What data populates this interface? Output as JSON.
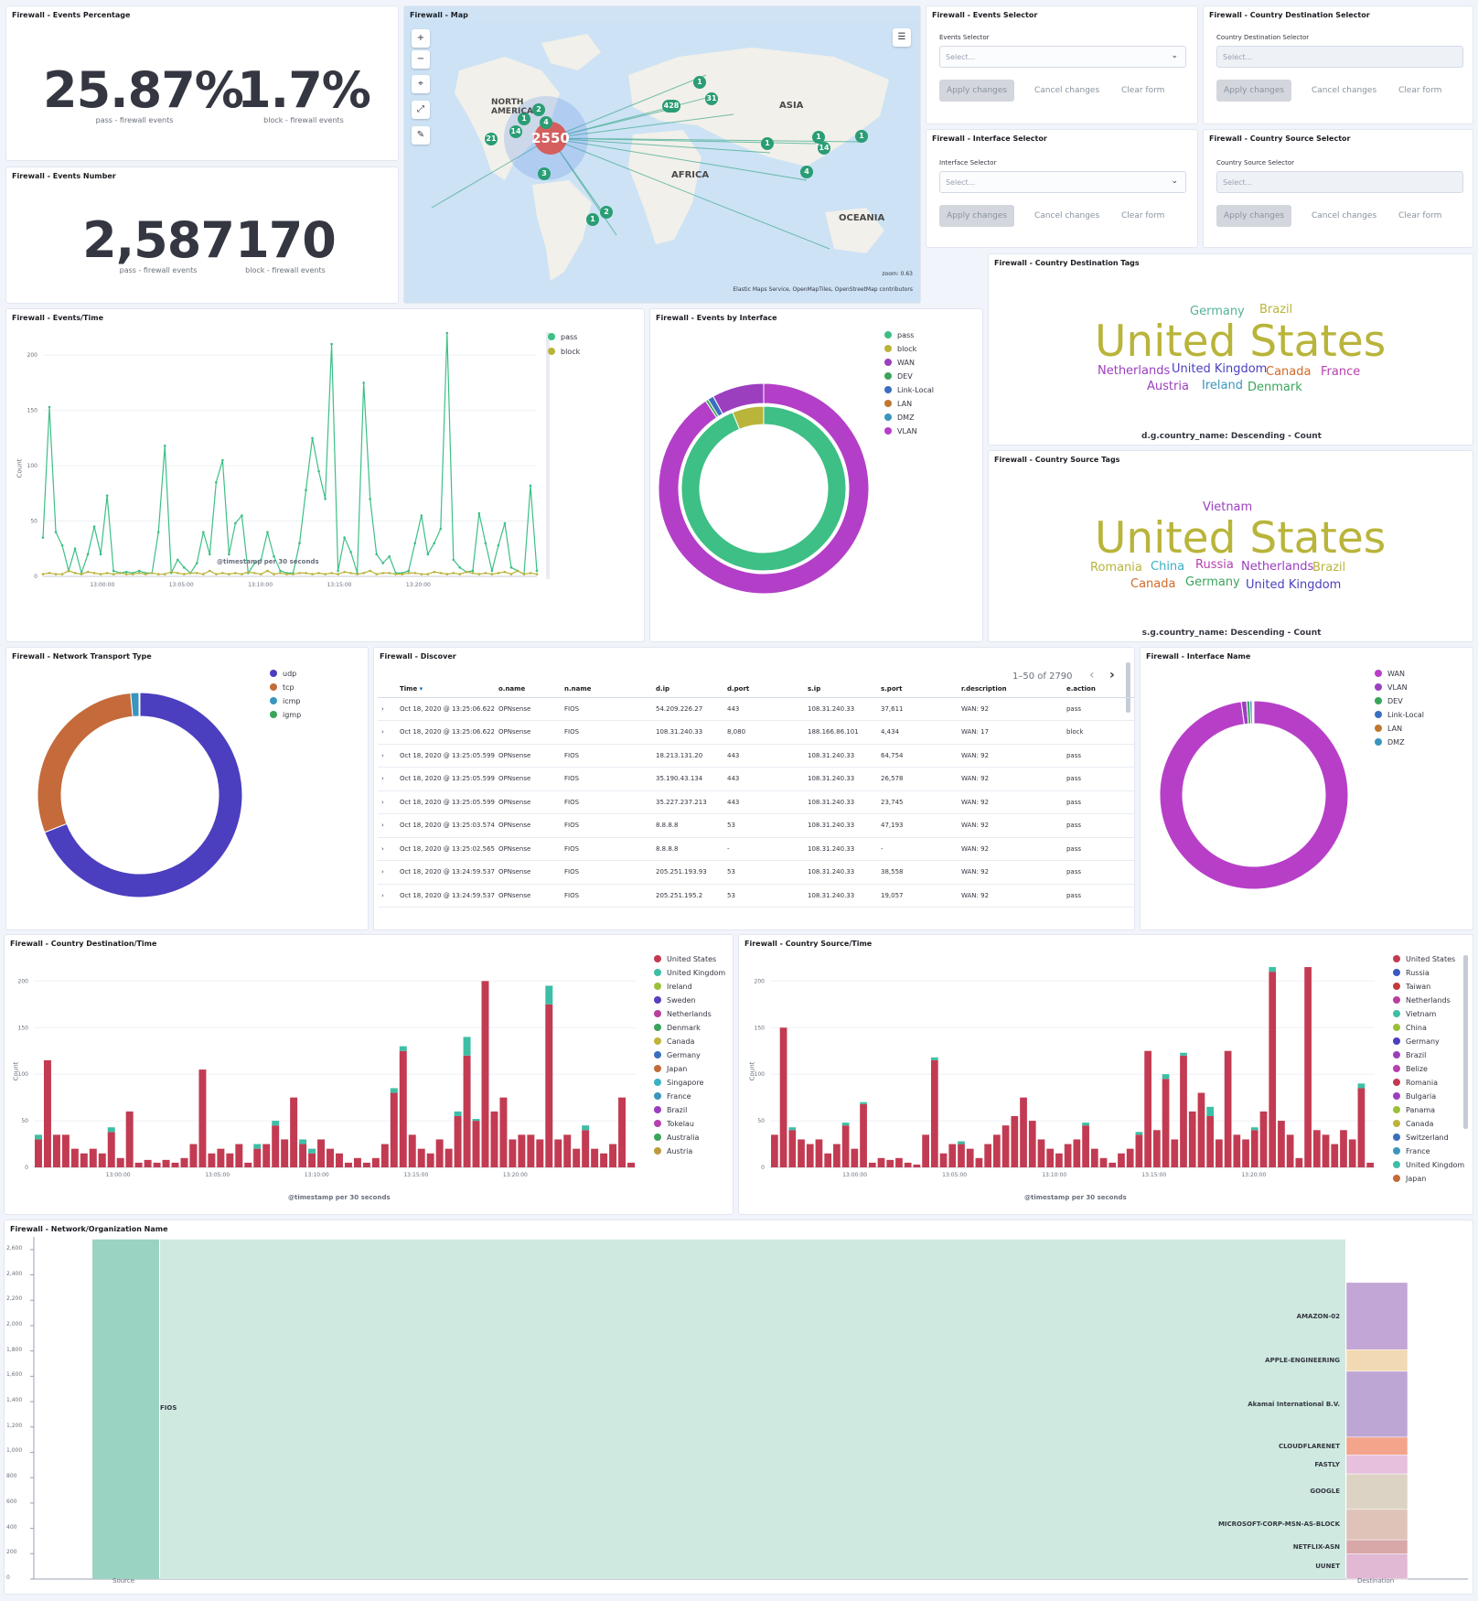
{
  "events_percentage": {
    "title": "Firewall - Events Percentage",
    "metrics": [
      {
        "value": "25.87%",
        "label": "pass - firewall events"
      },
      {
        "value": "1.7%",
        "label": "block - firewall events"
      }
    ]
  },
  "events_number": {
    "title": "Firewall - Events Number",
    "metrics": [
      {
        "value": "2,587",
        "label": "pass - firewall events"
      },
      {
        "value": "170",
        "label": "block - firewall events"
      }
    ]
  },
  "map": {
    "title": "Firewall - Map",
    "center_count": "2550",
    "zoom": "zoom: 0.63",
    "attribution": "Elastic Maps Service, OpenMapTiles, OpenStreetMap contributors",
    "labels": {
      "na": "NORTH AMERICA",
      "asia": "ASIA",
      "africa": "AFRICA",
      "oceania": "OCEANIA"
    },
    "clusters": [
      "2",
      "1",
      "14",
      "21",
      "3",
      "1",
      "2",
      "428",
      "31",
      "1",
      "1",
      "1",
      "14",
      "4",
      "1",
      "4"
    ],
    "controls": {
      "zoom_in": "+",
      "zoom_out": "−",
      "locate": "⌖",
      "expand": "⤢",
      "tools": "✎",
      "layers": "☰"
    }
  },
  "selectors": {
    "apply": "Apply changes",
    "cancel": "Cancel changes",
    "clear": "Clear form",
    "placeholder": "Select...",
    "events": {
      "title": "Firewall - Events Selector",
      "label": "Events Selector"
    },
    "country_dest": {
      "title": "Firewall - Country Destination Selector",
      "label": "Country Destination Selector"
    },
    "interface": {
      "title": "Firewall - Interface Selector",
      "label": "Interface Selector"
    },
    "country_src": {
      "title": "Firewall - Country Source Selector",
      "label": "Country Source Selector"
    }
  },
  "dest_tags": {
    "title": "Firewall - Country Destination Tags",
    "caption": "d.g.country_name: Descending - Count",
    "tags": [
      {
        "t": "Germany",
        "c": "#54b399"
      },
      {
        "t": "Brazil",
        "c": "#b9b43a"
      },
      {
        "t": "United States",
        "c": "#b9b43a"
      },
      {
        "t": "Netherlands",
        "c": "#9c3fbf"
      },
      {
        "t": "United Kingdom",
        "c": "#4b3fbf"
      },
      {
        "t": "Canada",
        "c": "#d36a2a"
      },
      {
        "t": "France",
        "c": "#b73fae"
      },
      {
        "t": "Austria",
        "c": "#9c3fbf"
      },
      {
        "t": "Ireland",
        "c": "#3a95be"
      },
      {
        "t": "Denmark",
        "c": "#3aa55a"
      }
    ]
  },
  "src_tags": {
    "title": "Firewall - Country Source Tags",
    "caption": "s.g.country_name: Descending - Count",
    "tags": [
      {
        "t": "Vietnam",
        "c": "#9c3fbf"
      },
      {
        "t": "United States",
        "c": "#b9b43a"
      },
      {
        "t": "Romania",
        "c": "#b9b43a"
      },
      {
        "t": "China",
        "c": "#3ab0c6"
      },
      {
        "t": "Russia",
        "c": "#b73fae"
      },
      {
        "t": "Netherlands",
        "c": "#9c3fbf"
      },
      {
        "t": "Brazil",
        "c": "#b9b43a"
      },
      {
        "t": "Canada",
        "c": "#d36a2a"
      },
      {
        "t": "Germany",
        "c": "#3aa55a"
      },
      {
        "t": "United Kingdom",
        "c": "#4b3fbf"
      }
    ]
  },
  "events_time": {
    "title": "Firewall - Events/Time",
    "legend": [
      {
        "name": "pass",
        "color": "#3dbf85"
      },
      {
        "name": "block",
        "color": "#b9b43a"
      }
    ]
  },
  "events_interface": {
    "title": "Firewall - Events by Interface",
    "legend": [
      {
        "name": "pass",
        "color": "#3dbf85"
      },
      {
        "name": "block",
        "color": "#b9b43a"
      },
      {
        "name": "WAN",
        "color": "#9c3fbf"
      },
      {
        "name": "DEV",
        "color": "#3aa55a"
      },
      {
        "name": "Link-Local",
        "color": "#3a6fbf"
      },
      {
        "name": "LAN",
        "color": "#c0772d"
      },
      {
        "name": "DMZ",
        "color": "#3a95be"
      },
      {
        "name": "VLAN",
        "color": "#b73fc8"
      }
    ]
  },
  "transport": {
    "title": "Firewall - Network Transport Type",
    "legend": [
      {
        "name": "udp",
        "color": "#4b3fbf"
      },
      {
        "name": "tcp",
        "color": "#c56a3a"
      },
      {
        "name": "icmp",
        "color": "#3a95be"
      },
      {
        "name": "igmp",
        "color": "#3aa55a"
      }
    ]
  },
  "interface_name": {
    "title": "Firewall - Interface Name",
    "legend": [
      {
        "name": "WAN",
        "color": "#b73fc8"
      },
      {
        "name": "VLAN",
        "color": "#9c3fbf"
      },
      {
        "name": "DEV",
        "color": "#3aa55a"
      },
      {
        "name": "Link-Local",
        "color": "#3a6fbf"
      },
      {
        "name": "LAN",
        "color": "#c0772d"
      },
      {
        "name": "DMZ",
        "color": "#3a95be"
      }
    ]
  },
  "discover": {
    "title": "Firewall - Discover",
    "pagination": "1–50 of 2790",
    "columns": [
      "Time",
      "o.name",
      "n.name",
      "d.ip",
      "d.port",
      "s.ip",
      "s.port",
      "r.description",
      "e.action"
    ],
    "rows": [
      [
        "Oct 18, 2020 @ 13:25:06.622",
        "OPNsense",
        "FIOS",
        "54.209.226.27",
        "443",
        "108.31.240.33",
        "37,611",
        "WAN: 92",
        "pass"
      ],
      [
        "Oct 18, 2020 @ 13:25:06.622",
        "OPNsense",
        "FIOS",
        "108.31.240.33",
        "8,080",
        "188.166.86.101",
        "4,434",
        "WAN: 17",
        "block"
      ],
      [
        "Oct 18, 2020 @ 13:25:05.599",
        "OPNsense",
        "FIOS",
        "18.213.131.20",
        "443",
        "108.31.240.33",
        "64,754",
        "WAN: 92",
        "pass"
      ],
      [
        "Oct 18, 2020 @ 13:25:05.599",
        "OPNsense",
        "FIOS",
        "35.190.43.134",
        "443",
        "108.31.240.33",
        "26,578",
        "WAN: 92",
        "pass"
      ],
      [
        "Oct 18, 2020 @ 13:25:05.599",
        "OPNsense",
        "FIOS",
        "35.227.237.213",
        "443",
        "108.31.240.33",
        "23,745",
        "WAN: 92",
        "pass"
      ],
      [
        "Oct 18, 2020 @ 13:25:03.574",
        "OPNsense",
        "FIOS",
        "8.8.8.8",
        "53",
        "108.31.240.33",
        "47,193",
        "WAN: 92",
        "pass"
      ],
      [
        "Oct 18, 2020 @ 13:25:02.565",
        "OPNsense",
        "FIOS",
        "8.8.8.8",
        "-",
        "108.31.240.33",
        "-",
        "WAN: 92",
        "pass"
      ],
      [
        "Oct 18, 2020 @ 13:24:59.537",
        "OPNsense",
        "FIOS",
        "205.251.193.93",
        "53",
        "108.31.240.33",
        "38,558",
        "WAN: 92",
        "pass"
      ],
      [
        "Oct 18, 2020 @ 13:24:59.537",
        "OPNsense",
        "FIOS",
        "205.251.195.2",
        "53",
        "108.31.240.33",
        "19,057",
        "WAN: 92",
        "pass"
      ]
    ]
  },
  "country_dest_time": {
    "title": "Firewall - Country Destination/Time",
    "xlabel": "@timestamp per 30 seconds",
    "ylabel": "Count",
    "legend": [
      {
        "name": "United States",
        "color": "#c23b52"
      },
      {
        "name": "United Kingdom",
        "color": "#3dbfa5"
      },
      {
        "name": "Ireland",
        "color": "#9cbf3a"
      },
      {
        "name": "Sweden",
        "color": "#5a3fbf"
      },
      {
        "name": "Netherlands",
        "color": "#b73f9e"
      },
      {
        "name": "Denmark",
        "color": "#3aa55a"
      },
      {
        "name": "Canada",
        "color": "#bfb43a"
      },
      {
        "name": "Germany",
        "color": "#3a6fbf"
      },
      {
        "name": "Japan",
        "color": "#c56a3a"
      },
      {
        "name": "Singapore",
        "color": "#3ab0c6"
      },
      {
        "name": "France",
        "color": "#3a95be"
      },
      {
        "name": "Brazil",
        "color": "#9c3fbf"
      },
      {
        "name": "Tokelau",
        "color": "#b73fae"
      },
      {
        "name": "Australia",
        "color": "#3aa55a"
      },
      {
        "name": "Austria",
        "color": "#bf9a3a"
      }
    ]
  },
  "country_src_time": {
    "title": "Firewall - Country Source/Time",
    "xlabel": "@timestamp per 30 seconds",
    "ylabel": "Count",
    "legend": [
      {
        "name": "United States",
        "color": "#c23b52"
      },
      {
        "name": "Russia",
        "color": "#3a5abf"
      },
      {
        "name": "Taiwan",
        "color": "#c23b3b"
      },
      {
        "name": "Netherlands",
        "color": "#b73f9e"
      },
      {
        "name": "Vietnam",
        "color": "#3dbfa5"
      },
      {
        "name": "China",
        "color": "#9cbf3a"
      },
      {
        "name": "Germany",
        "color": "#4b3fbf"
      },
      {
        "name": "Brazil",
        "color": "#9c3fbf"
      },
      {
        "name": "Belize",
        "color": "#b73fae"
      },
      {
        "name": "Romania",
        "color": "#c23b52"
      },
      {
        "name": "Bulgaria",
        "color": "#9c3fbf"
      },
      {
        "name": "Panama",
        "color": "#9cbf3a"
      },
      {
        "name": "Canada",
        "color": "#bfb43a"
      },
      {
        "name": "Switzerland",
        "color": "#3a6fbf"
      },
      {
        "name": "France",
        "color": "#3a95be"
      },
      {
        "name": "United Kingdom",
        "color": "#3dbfa5"
      },
      {
        "name": "Japan",
        "color": "#c56a3a"
      }
    ]
  },
  "org": {
    "title": "Firewall - Network/Organization Name",
    "source_name": "FIOS",
    "xlabels": [
      "Source",
      "Destination"
    ],
    "yticks": [
      "2,600",
      "2,400",
      "2,200",
      "2,000",
      "1,800",
      "1,600",
      "1,400",
      "1,200",
      "1,000",
      "800",
      "600",
      "400",
      "200",
      "0"
    ],
    "dest": [
      "AMAZON-02",
      "APPLE-ENGINEERING",
      "Akamai International B.V.",
      "CLOUDFLARENET",
      "FASTLY",
      "GOOGLE",
      "MICROSOFT-CORP-MSN-AS-BLOCK",
      "NETFLIX-ASN",
      "UUNET"
    ]
  },
  "chart_data": [
    {
      "type": "line",
      "title": "Firewall - Events/Time",
      "xlabel": "@timestamp per 30 seconds",
      "ylabel": "Count",
      "ylim": [
        0,
        220
      ],
      "x": [
        "13:00:00",
        "13:05:00",
        "13:10:00",
        "13:15:00",
        "13:20:00"
      ],
      "series": [
        {
          "name": "pass",
          "values": [
            35,
            153,
            40,
            28,
            5,
            25,
            3,
            20,
            45,
            20,
            73,
            5,
            3,
            4,
            3,
            5,
            3,
            3,
            40,
            118,
            3,
            15,
            8,
            3,
            12,
            40,
            20,
            85,
            105,
            20,
            48,
            55,
            3,
            12,
            15,
            40,
            18,
            5,
            3,
            3,
            30,
            78,
            125,
            95,
            70,
            210,
            5,
            35,
            22,
            3,
            175,
            70,
            20,
            12,
            18,
            3,
            3,
            5,
            30,
            55,
            20,
            30,
            43,
            220,
            15,
            8,
            4,
            5,
            57,
            30,
            5,
            28,
            48,
            8,
            5,
            2,
            82,
            5
          ]
        },
        {
          "name": "block",
          "values": [
            2,
            3,
            2,
            2,
            5,
            3,
            2,
            4,
            3,
            2,
            3,
            2,
            3,
            2,
            2,
            3,
            2,
            3,
            2,
            2,
            4,
            3,
            2,
            3,
            3,
            2,
            5,
            2,
            3,
            2,
            3,
            2,
            4,
            3,
            2,
            5,
            2,
            3,
            2,
            2,
            3,
            3,
            2,
            3,
            2,
            3,
            2,
            4,
            3,
            2,
            3,
            5,
            2,
            3,
            3,
            2,
            2,
            3,
            3,
            2,
            2,
            4,
            3,
            2,
            3,
            2,
            4,
            3,
            2,
            3,
            2,
            3,
            4,
            2,
            5,
            2,
            3,
            2
          ]
        }
      ]
    },
    {
      "type": "pie",
      "title": "Firewall - Events by Interface",
      "inner": [
        {
          "name": "pass",
          "value": 2587
        },
        {
          "name": "block",
          "value": 170
        }
      ],
      "outer": [
        {
          "name": "VLAN",
          "value": 2500
        },
        {
          "name": "DEV",
          "value": 12
        },
        {
          "name": "Link-Local",
          "value": 25
        },
        {
          "name": "WAN",
          "value": 220
        }
      ]
    },
    {
      "type": "pie",
      "title": "Firewall - Network Transport Type",
      "slices": [
        {
          "name": "udp",
          "value": 1850
        },
        {
          "name": "tcp",
          "value": 790
        },
        {
          "name": "icmp",
          "value": 35
        },
        {
          "name": "igmp",
          "value": 4
        }
      ]
    },
    {
      "type": "pie",
      "title": "Firewall - Interface Name",
      "slices": [
        {
          "name": "WAN",
          "value": 2680
        },
        {
          "name": "VLAN",
          "value": 25
        },
        {
          "name": "DEV",
          "value": 15
        },
        {
          "name": "Link-Local",
          "value": 10
        },
        {
          "name": "LAN",
          "value": 5
        },
        {
          "name": "DMZ",
          "value": 4
        }
      ]
    },
    {
      "type": "bar",
      "title": "Firewall - Country Destination/Time",
      "xlabel": "@timestamp per 30 seconds",
      "ylabel": "Count",
      "ylim": [
        0,
        220
      ],
      "x": [
        "13:00:00",
        "13:05:00",
        "13:10:00",
        "13:15:00",
        "13:20:00"
      ],
      "values": [
        30,
        115,
        35,
        35,
        20,
        15,
        20,
        15,
        38,
        10,
        60,
        5,
        8,
        5,
        8,
        5,
        10,
        25,
        105,
        15,
        20,
        15,
        25,
        5,
        20,
        25,
        45,
        30,
        75,
        25,
        15,
        30,
        20,
        15,
        5,
        10,
        5,
        10,
        25,
        80,
        125,
        35,
        20,
        15,
        30,
        20,
        55,
        120,
        50,
        200,
        60,
        75,
        30,
        35,
        35,
        30,
        175,
        30,
        35,
        20,
        40,
        20,
        15,
        25,
        75,
        5
      ],
      "other": [
        5,
        0,
        0,
        0,
        0,
        0,
        0,
        0,
        5,
        0,
        0,
        0,
        0,
        0,
        0,
        0,
        0,
        0,
        0,
        0,
        0,
        0,
        0,
        0,
        5,
        0,
        5,
        0,
        0,
        5,
        5,
        0,
        0,
        0,
        0,
        0,
        0,
        0,
        0,
        5,
        5,
        0,
        0,
        0,
        0,
        0,
        5,
        20,
        2,
        0,
        0,
        0,
        0,
        0,
        0,
        0,
        20,
        0,
        0,
        0,
        5,
        0,
        0,
        0,
        0,
        0
      ]
    },
    {
      "type": "bar",
      "title": "Firewall - Country Source/Time",
      "xlabel": "@timestamp per 30 seconds",
      "ylabel": "Count",
      "ylim": [
        0,
        220
      ],
      "x": [
        "13:00:00",
        "13:05:00",
        "13:10:00",
        "13:15:00",
        "13:20:00"
      ],
      "values": [
        35,
        150,
        40,
        30,
        25,
        30,
        15,
        25,
        45,
        20,
        68,
        5,
        10,
        8,
        10,
        5,
        3,
        35,
        115,
        15,
        25,
        25,
        20,
        10,
        25,
        35,
        45,
        55,
        75,
        50,
        30,
        20,
        15,
        25,
        30,
        45,
        20,
        10,
        5,
        15,
        20,
        35,
        125,
        40,
        95,
        30,
        120,
        60,
        80,
        55,
        30,
        125,
        35,
        30,
        40,
        60,
        210,
        50,
        35,
        10,
        215,
        40,
        35,
        25,
        40,
        30,
        85,
        5
      ],
      "other": [
        0,
        0,
        3,
        0,
        0,
        0,
        0,
        0,
        3,
        0,
        2,
        0,
        0,
        0,
        0,
        0,
        0,
        0,
        3,
        0,
        0,
        3,
        0,
        0,
        0,
        0,
        0,
        0,
        0,
        0,
        0,
        0,
        0,
        0,
        0,
        3,
        0,
        0,
        0,
        0,
        0,
        3,
        0,
        0,
        5,
        0,
        3,
        0,
        0,
        10,
        0,
        0,
        0,
        0,
        3,
        0,
        5,
        0,
        0,
        0,
        0,
        0,
        0,
        0,
        0,
        0,
        5,
        0
      ]
    },
    {
      "type": "bar",
      "title": "Firewall - Network/Organization Name",
      "categories": [
        "Source",
        "Destination"
      ],
      "ylim": [
        0,
        2700
      ],
      "source": [
        {
          "name": "FIOS",
          "value": 2680
        }
      ],
      "destination": [
        {
          "name": "UUNET",
          "value": 200
        },
        {
          "name": "NETFLIX-ASN",
          "value": 110
        },
        {
          "name": "MICROSOFT-CORP-MSN-AS-BLOCK",
          "value": 240
        },
        {
          "name": "GOOGLE",
          "value": 280
        },
        {
          "name": "FASTLY",
          "value": 150
        },
        {
          "name": "CLOUDFLARENET",
          "value": 140
        },
        {
          "name": "Akamai International B.V.",
          "value": 520
        },
        {
          "name": "APPLE-ENGINEERING",
          "value": 170
        },
        {
          "name": "AMAZON-02",
          "value": 530
        }
      ]
    }
  ]
}
